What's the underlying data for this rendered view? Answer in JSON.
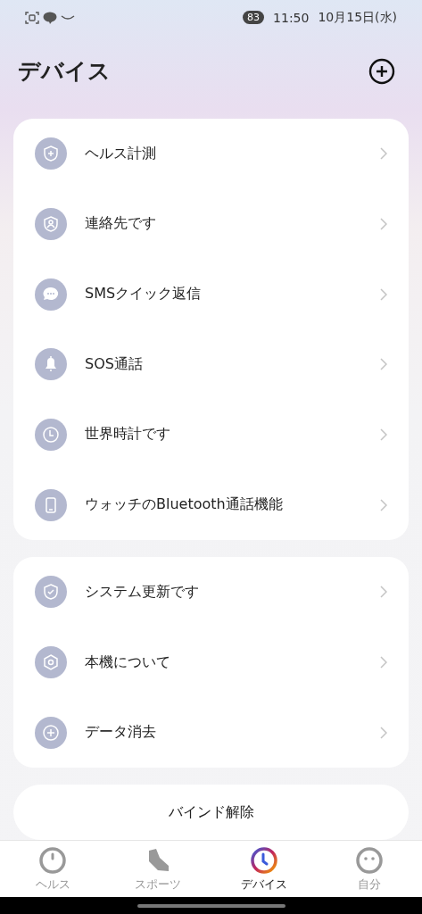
{
  "status_bar": {
    "battery": "83",
    "time": "11:50",
    "date": "10月15日(水)"
  },
  "header": {
    "title": "デバイス"
  },
  "groups": [
    {
      "items": [
        {
          "label": "ヘルス計測"
        },
        {
          "label": "連絡先です"
        },
        {
          "label": "SMSクイック返信"
        },
        {
          "label": "SOS通話"
        },
        {
          "label": "世界時計です"
        },
        {
          "label": "ウォッチのBluetooth通話機能"
        }
      ]
    },
    {
      "items": [
        {
          "label": "システム更新です"
        },
        {
          "label": "本機について"
        },
        {
          "label": "データ消去"
        }
      ]
    }
  ],
  "unbind_button": "バインド解除",
  "tabs": [
    {
      "label": "ヘルス",
      "selected": false
    },
    {
      "label": "スポーツ",
      "selected": false
    },
    {
      "label": "デバイス",
      "selected": true
    },
    {
      "label": "自分",
      "selected": false
    }
  ]
}
